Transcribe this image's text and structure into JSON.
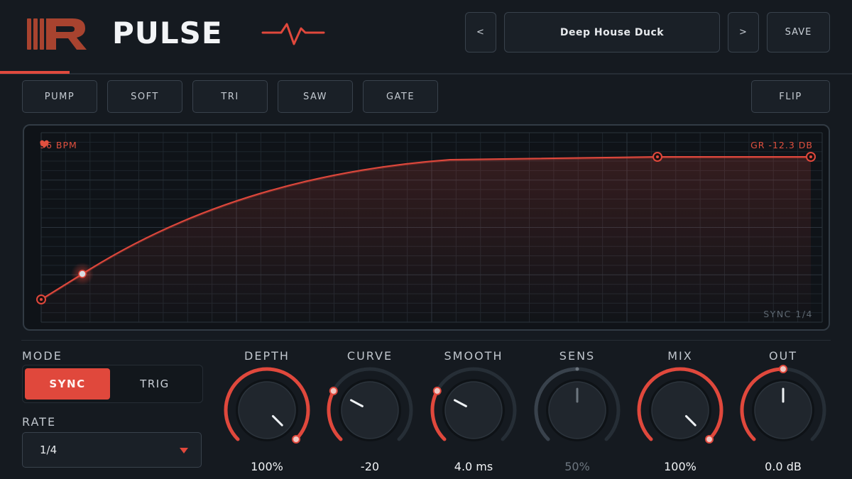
{
  "header": {
    "title": "PULSE",
    "preset": {
      "prev_label": "<",
      "name": "Deep House Duck",
      "next_label": ">",
      "save_label": "SAVE"
    }
  },
  "shapes": {
    "items": [
      "PUMP",
      "SOFT",
      "TRI",
      "SAW",
      "GATE"
    ],
    "flip_label": "FLIP"
  },
  "graph": {
    "bpm_label": "96 BPM",
    "gr_label": "GR -12.3 DB",
    "sync_label": "SYNC 1/4"
  },
  "controls": {
    "mode_label": "MODE",
    "mode_options": [
      "SYNC",
      "TRIG"
    ],
    "mode_selected": "SYNC",
    "rate_label": "RATE",
    "rate_value": "1/4"
  },
  "knobs": [
    {
      "name": "DEPTH",
      "value": "100%",
      "level": 1.0
    },
    {
      "name": "CURVE",
      "value": "-20",
      "level": 0.27
    },
    {
      "name": "SMOOTH",
      "value": "4.0 ms",
      "level": 0.27
    },
    {
      "name": "SENS",
      "value": "50%",
      "level": 0.5,
      "dim": true
    },
    {
      "name": "MIX",
      "value": "100%",
      "level": 1.0
    },
    {
      "name": "OUT",
      "value": "0.0 dB",
      "level": 0.5
    }
  ],
  "colors": {
    "accent": "#e0483c",
    "background": "#151a20",
    "panel_border": "#39424c"
  }
}
